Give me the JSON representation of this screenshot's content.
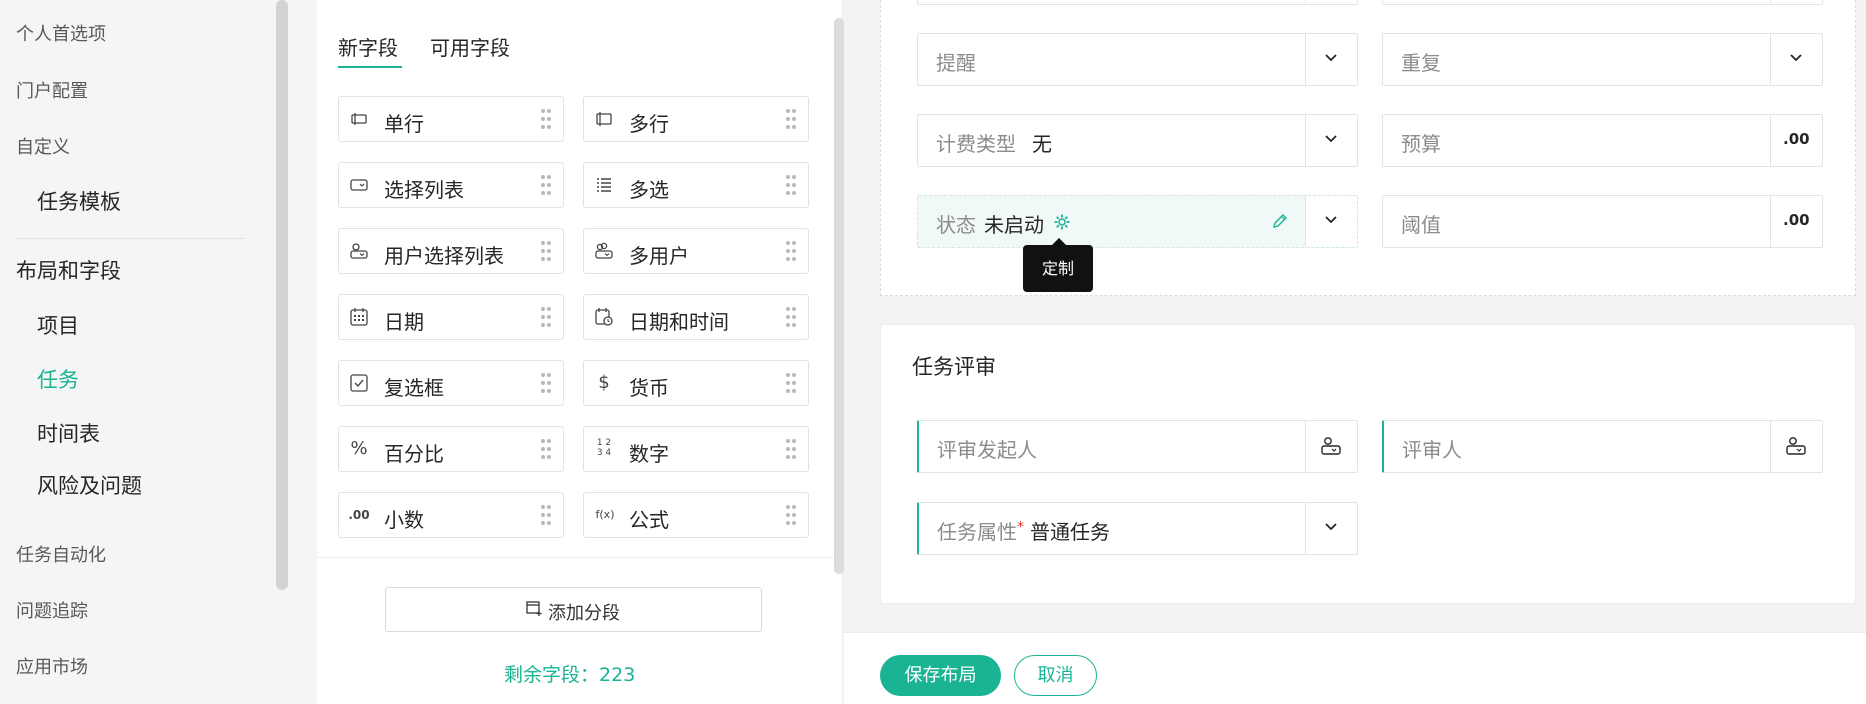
{
  "nav": {
    "items": [
      "个人首选项",
      "门户配置",
      "自定义"
    ],
    "task_template": "任务模板",
    "layout_fields": "布局和字段",
    "sub_items": [
      "项目",
      "任务",
      "时间表",
      "风险及问题"
    ],
    "bottom_items": [
      "任务自动化",
      "问题追踪",
      "应用市场"
    ],
    "active_color": "#1ab394"
  },
  "fields_panel": {
    "tabs": [
      "新字段",
      "可用字段"
    ],
    "fields": [
      {
        "label": "单行",
        "icon": "single-line-icon"
      },
      {
        "label": "多行",
        "icon": "multi-line-icon"
      },
      {
        "label": "选择列表",
        "icon": "pick-list-icon"
      },
      {
        "label": "多选",
        "icon": "multi-select-icon"
      },
      {
        "label": "用户选择列表",
        "icon": "user-pick-list-icon"
      },
      {
        "label": "多用户",
        "icon": "multi-user-icon"
      },
      {
        "label": "日期",
        "icon": "calendar-icon"
      },
      {
        "label": "日期和时间",
        "icon": "calendar-clock-icon"
      },
      {
        "label": "复选框",
        "icon": "checkbox-icon"
      },
      {
        "label": "货币",
        "icon": "dollar-icon"
      },
      {
        "label": "百分比",
        "icon": "percent-icon"
      },
      {
        "label": "数字",
        "icon": "number-icon"
      },
      {
        "label": "小数",
        "icon": "decimal-icon"
      },
      {
        "label": "公式",
        "icon": "formula-icon"
      }
    ],
    "glyphs": {
      "percent": "%",
      "dollar": "$",
      "number_top": "1 2",
      "number_bottom": "3 4",
      "decimal": ".00",
      "formula": "f(x)"
    },
    "add_section": "添加分段",
    "remaining_label": "剩余字段：",
    "remaining_count": "223"
  },
  "layout": {
    "reminder": "提醒",
    "repeat": "重复",
    "billing_type_label": "计费类型",
    "billing_type_value": "无",
    "budget": "预算",
    "decimal_suffix": ".00",
    "status_label": "状态",
    "status_value": "未启动",
    "threshold": "阈值",
    "tooltip": "定制",
    "review_title": "任务评审",
    "review_initiator": "评审发起人",
    "reviewer": "评审人",
    "task_attr_label": "任务属性",
    "required_mark": "*",
    "task_attr_value": "普通任务"
  },
  "footer": {
    "save": "保存布局",
    "cancel": "取消"
  }
}
